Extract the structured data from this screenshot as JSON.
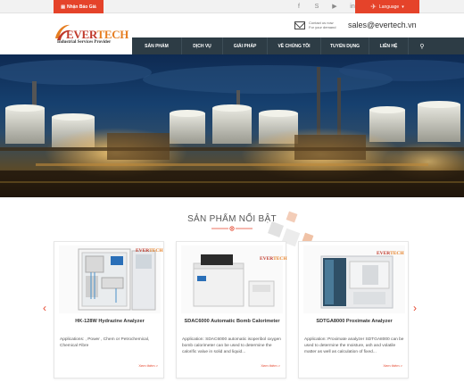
{
  "topbar": {
    "quote_label": "Nhận Báo Giá",
    "language_label": "Language",
    "socials": [
      "facebook-icon",
      "skype-icon",
      "youtube-icon",
      "linkedin-icon"
    ]
  },
  "header": {
    "logo_text_red": "EVER",
    "logo_text_orange": "TECH",
    "logo_tagline": "Industrial Services Provider",
    "contact_small_1": "Contact us now",
    "contact_small_2": "For your demand",
    "email": "sales@evertech.vn"
  },
  "nav": {
    "items": [
      "SẢN PHẨM",
      "DỊCH VỤ",
      "GIẢI PHÁP",
      "VỀ CHÚNG TÔI",
      "TUYỂN DỤNG",
      "LIÊN HỆ"
    ]
  },
  "section": {
    "title": "SẢN PHẨM NỔI BẬT"
  },
  "products": [
    {
      "name": "HK-128W Hydrazine Analyzer",
      "desc": "Applications: , Power , Chem or Petrochemical, Chemical Fibre",
      "more": "Xem thêm >"
    },
    {
      "name": "SDAC6000 Automatic Bomb Calorimeter",
      "desc": "Application: SDAC6000 automatic isoperibol oxygen bomb calorimeter can be used to determine the calorific value in solid and liquid...",
      "more": "Xem thêm >"
    },
    {
      "name": "SDTGA8000 Proximate Analyzer",
      "desc": "Application: Proximate analyzer SDTGA8000 can be used to determine the moisture, ash and volatile matter as well as calculation of fixed...",
      "more": "Xem thêm >"
    }
  ],
  "colors": {
    "accent": "#e5432a",
    "nav_bg": "#2d3c45"
  }
}
